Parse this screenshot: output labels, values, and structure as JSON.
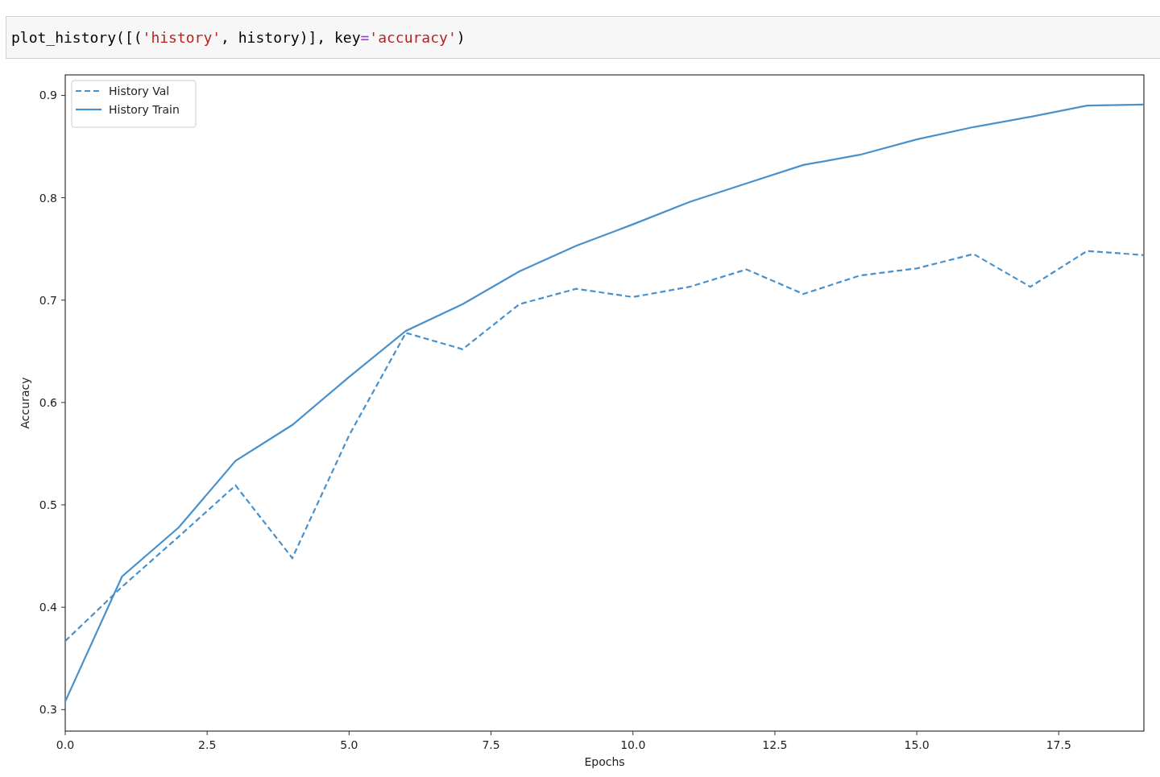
{
  "code_cell": {
    "tokens": [
      {
        "kind": "plain",
        "text": "plot_history([("
      },
      {
        "kind": "string",
        "text": "'history'"
      },
      {
        "kind": "plain",
        "text": ", history)], key"
      },
      {
        "kind": "operator",
        "text": "="
      },
      {
        "kind": "string",
        "text": "'accuracy'"
      },
      {
        "kind": "plain",
        "text": ")"
      }
    ]
  },
  "output": {
    "chart_data": {
      "type": "line",
      "xlabel": "Epochs",
      "ylabel": "Accuracy",
      "x": [
        0,
        1,
        2,
        3,
        4,
        5,
        6,
        7,
        8,
        9,
        10,
        11,
        12,
        13,
        14,
        15,
        16,
        17,
        18,
        19
      ],
      "series": [
        {
          "name": "History Val",
          "color": "#4891cc",
          "line_style": "dashed",
          "values": [
            0.367,
            0.42,
            0.469,
            0.519,
            0.448,
            0.568,
            0.668,
            0.652,
            0.696,
            0.711,
            0.703,
            0.713,
            0.73,
            0.706,
            0.724,
            0.731,
            0.745,
            0.713,
            0.748,
            0.744
          ]
        },
        {
          "name": "History Train",
          "color": "#4891cc",
          "line_style": "solid",
          "values": [
            0.308,
            0.43,
            0.478,
            0.543,
            0.578,
            0.625,
            0.67,
            0.696,
            0.728,
            0.753,
            0.774,
            0.796,
            0.814,
            0.832,
            0.842,
            0.857,
            0.869,
            0.879,
            0.89,
            0.891
          ]
        }
      ],
      "xlim": [
        0,
        19
      ],
      "ylim": [
        0.279,
        0.92
      ],
      "xticks": [
        {
          "value": 0,
          "label": "0.0"
        },
        {
          "value": 2.5,
          "label": "2.5"
        },
        {
          "value": 5,
          "label": "5.0"
        },
        {
          "value": 7.5,
          "label": "7.5"
        },
        {
          "value": 10,
          "label": "10.0"
        },
        {
          "value": 12.5,
          "label": "12.5"
        },
        {
          "value": 15,
          "label": "15.0"
        },
        {
          "value": 17.5,
          "label": "17.5"
        }
      ],
      "yticks": [
        0.3,
        0.4,
        0.5,
        0.6,
        0.7,
        0.8,
        0.9
      ],
      "legend": "upper left"
    }
  }
}
